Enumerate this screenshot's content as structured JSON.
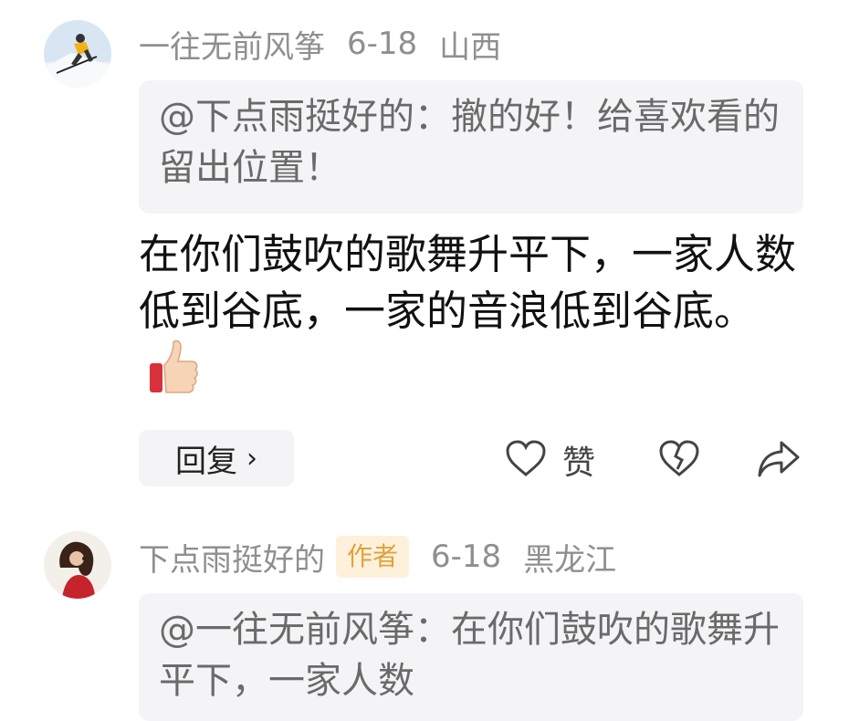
{
  "comments": [
    {
      "username": "一往无前风筝",
      "date": "6-18",
      "location": "山西",
      "avatar_icon": "skier-avatar",
      "quote_text": "@下点雨挺好的：撤的好！给喜欢看的留出位置！",
      "body_text": "在你们鼓吹的歌舞升平下，一家人数低到谷底，一家的音浪低到谷底。",
      "reply_label": "回复",
      "reply_chevron": "›",
      "like_label": "赞"
    },
    {
      "username": "下点雨挺好的",
      "author_badge": "作者",
      "date": "6-18",
      "location": "黑龙江",
      "avatar_icon": "woman-avatar",
      "quote_text": "@一往无前风筝：在你们鼓吹的歌舞升平下，一家人数"
    }
  ],
  "colors": {
    "meta_text": "#8f8f8f",
    "quote_bg": "#f4f4f6",
    "badge_bg": "#fdf1dc",
    "badge_text": "#e0a23c"
  }
}
